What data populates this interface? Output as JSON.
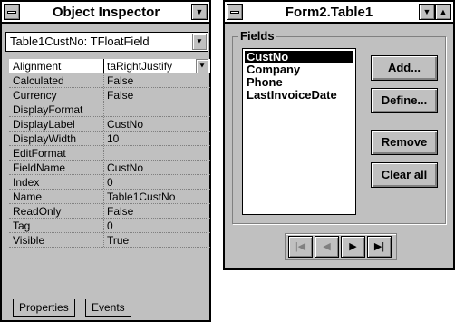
{
  "inspector": {
    "title": "Object Inspector",
    "component_selector": "Table1CustNo: TFloatField",
    "properties": [
      {
        "name": "Alignment",
        "value": "taRightJustify"
      },
      {
        "name": "Calculated",
        "value": "False"
      },
      {
        "name": "Currency",
        "value": "False"
      },
      {
        "name": "DisplayFormat",
        "value": ""
      },
      {
        "name": "DisplayLabel",
        "value": "CustNo"
      },
      {
        "name": "DisplayWidth",
        "value": "10"
      },
      {
        "name": "EditFormat",
        "value": ""
      },
      {
        "name": "FieldName",
        "value": "CustNo"
      },
      {
        "name": "Index",
        "value": "0"
      },
      {
        "name": "Name",
        "value": "Table1CustNo"
      },
      {
        "name": "ReadOnly",
        "value": "False"
      },
      {
        "name": "Tag",
        "value": "0"
      },
      {
        "name": "Visible",
        "value": "True"
      }
    ],
    "tabs": [
      "Properties",
      "Events"
    ]
  },
  "fields_editor": {
    "title": "Form2.Table1",
    "group_label": "Fields",
    "fields": [
      "CustNo",
      "Company",
      "Phone",
      "LastInvoiceDate"
    ],
    "selected_field": "CustNo",
    "buttons": {
      "add": "Add...",
      "define": "Define...",
      "remove": "Remove",
      "clear_all": "Clear all"
    }
  }
}
